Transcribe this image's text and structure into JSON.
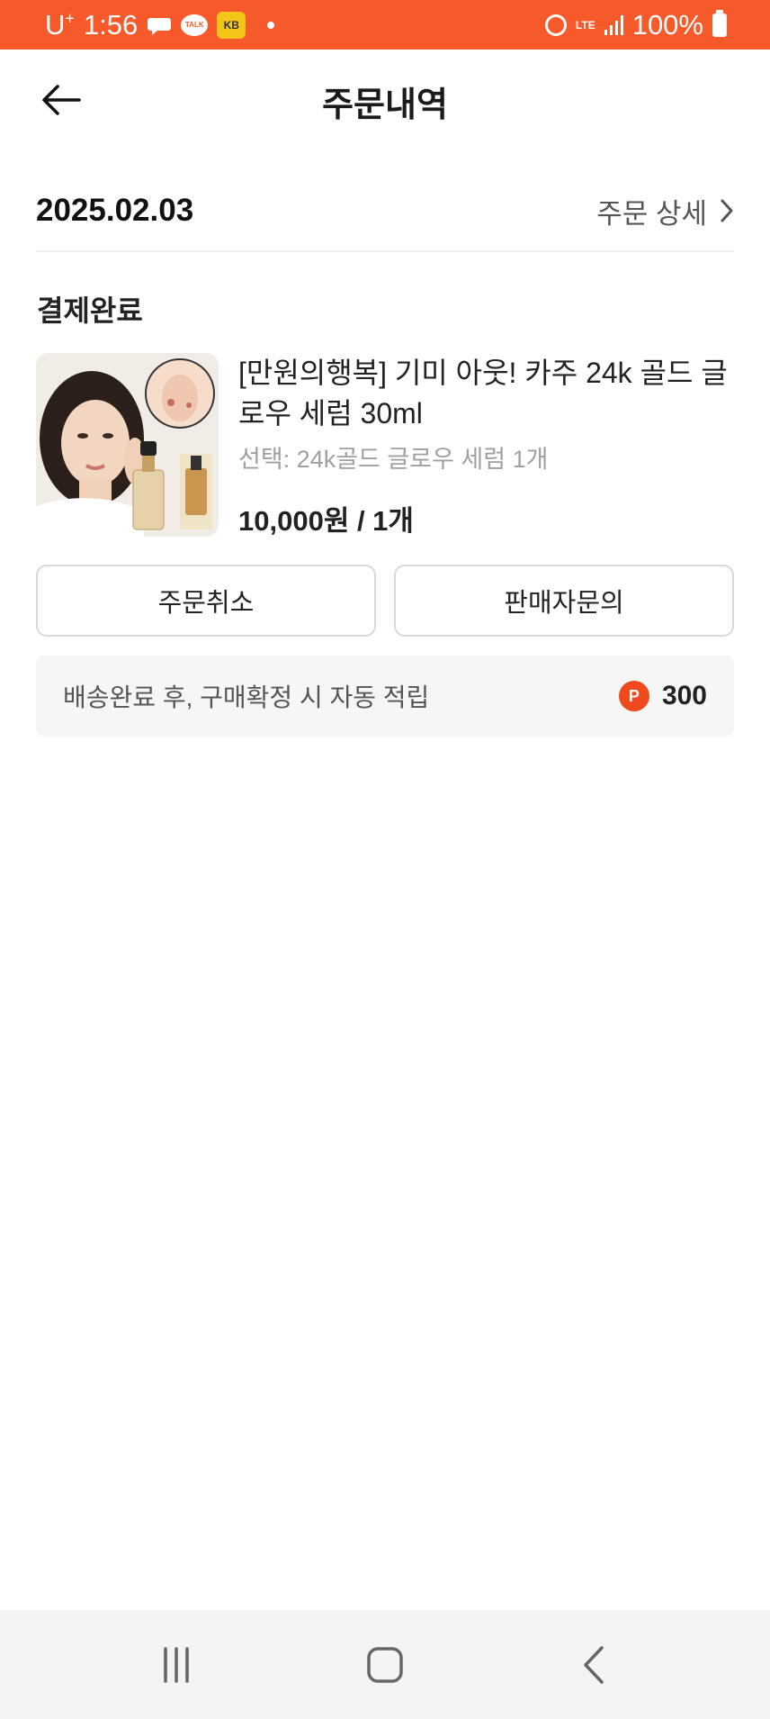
{
  "status_bar": {
    "carrier": "U",
    "carrier_sup": "+",
    "time": "1:56",
    "talk_label": "TALK",
    "kb_label": "KB",
    "network": "LTE",
    "battery": "100%"
  },
  "header": {
    "title": "주문내역",
    "back_icon": "arrow-left-icon"
  },
  "order": {
    "date": "2025.02.03",
    "detail_link": "주문 상세",
    "status": "결제완료"
  },
  "product": {
    "name": "[만원의행복] 기미 아웃! 카주 24k 골드 글로우 세럼 30ml",
    "option": "선택: 24k골드 글로우 세럼 1개",
    "price": "10,000원 / 1개"
  },
  "actions": {
    "cancel_label": "주문취소",
    "inquiry_label": "판매자문의"
  },
  "points": {
    "text": "배송완료 후, 구매확정 시 자동 적립",
    "icon_letter": "P",
    "value": "300"
  },
  "colors": {
    "accent": "#f75a2a",
    "point_icon": "#ef4a1d"
  }
}
